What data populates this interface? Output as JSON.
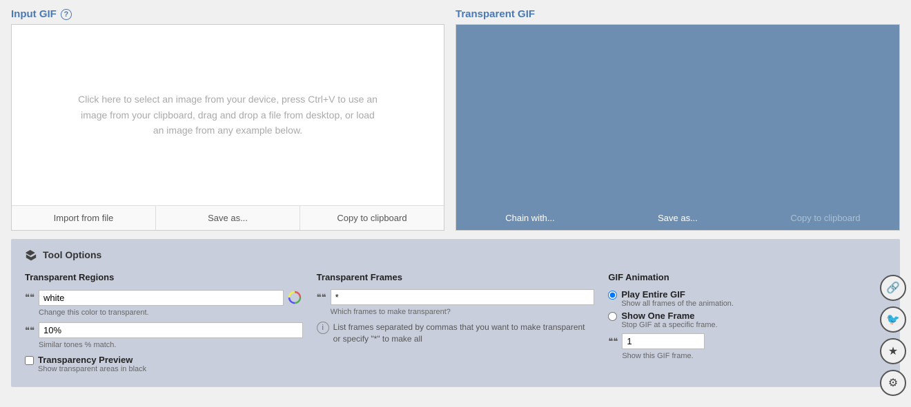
{
  "panels": {
    "input": {
      "title": "Input GIF",
      "help_icon": "?",
      "upload_text": "Click here to select an image from your device, press Ctrl+V to use an image from your clipboard, drag and drop a file from desktop, or load an image from any example below.",
      "actions": [
        {
          "label": "Import from file",
          "name": "import-from-file"
        },
        {
          "label": "Save as...",
          "name": "save-as-input"
        },
        {
          "label": "Copy to clipboard",
          "name": "copy-to-clipboard-input"
        }
      ]
    },
    "output": {
      "title": "Transparent GIF",
      "actions": [
        {
          "label": "Chain with...",
          "name": "chain-with",
          "disabled": false
        },
        {
          "label": "Save as...",
          "name": "save-as-output",
          "disabled": false
        },
        {
          "label": "Copy to clipboard",
          "name": "copy-to-clipboard-output",
          "disabled": true
        }
      ]
    }
  },
  "tool_options": {
    "header": "Tool Options",
    "sections": {
      "transparent_regions": {
        "title": "Transparent Regions",
        "color_input_value": "white",
        "color_input_placeholder": "white",
        "color_hint": "Change this color to transparent.",
        "tolerance_value": "10%",
        "tolerance_hint": "Similar tones % match.",
        "preview_label": "Transparency Preview",
        "preview_hint": "Show transparent areas in black"
      },
      "transparent_frames": {
        "title": "Transparent Frames",
        "frames_input_value": "*",
        "frames_placeholder": "*",
        "frames_hint": "Which frames to make transparent?",
        "info_text": "List frames separated by commas that you want to make transparent or specify \"*\" to make all"
      },
      "gif_animation": {
        "title": "GIF Animation",
        "options": [
          {
            "label": "Play Entire GIF",
            "hint": "Show all frames of the animation.",
            "name": "play-entire-gif",
            "selected": true
          },
          {
            "label": "Show One Frame",
            "hint": "Stop GIF at a specific frame.",
            "name": "show-one-frame",
            "selected": false
          }
        ],
        "frame_input_value": "1",
        "frame_hint": "Show this GIF frame."
      }
    }
  },
  "sidebar": {
    "icons": [
      {
        "name": "link-icon",
        "symbol": "🔗"
      },
      {
        "name": "twitter-icon",
        "symbol": "🐦"
      },
      {
        "name": "star-icon",
        "symbol": "★"
      },
      {
        "name": "settings-icon",
        "symbol": "⚙"
      }
    ]
  }
}
